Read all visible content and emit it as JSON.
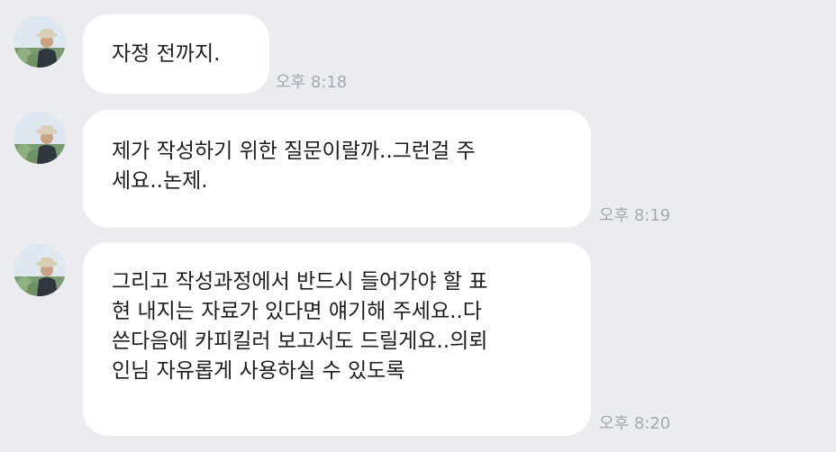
{
  "messages": [
    {
      "lines": [
        "자정 전까지."
      ],
      "time": "오후 8:18"
    },
    {
      "lines": [
        "제가 작성하기 위한 질문이랄까..그런걸 주",
        "세요..논제."
      ],
      "time": "오후 8:19"
    },
    {
      "lines": [
        "그리고 작성과정에서 반드시 들어가야 할 표",
        "현 내지는 자료가 있다면 얘기해 주세요..다",
        "쓴다음에 카피킬러 보고서도 드릴게요..의뢰",
        "인님 자유롭게 사용하실 수 있도록"
      ],
      "time": "오후 8:20"
    }
  ],
  "colors": {
    "background": "#eaecf0",
    "bubble": "#ffffff",
    "text": "#1e1e1e",
    "timestamp": "#a2a9b3"
  },
  "icons": [
    "profile-avatar"
  ]
}
